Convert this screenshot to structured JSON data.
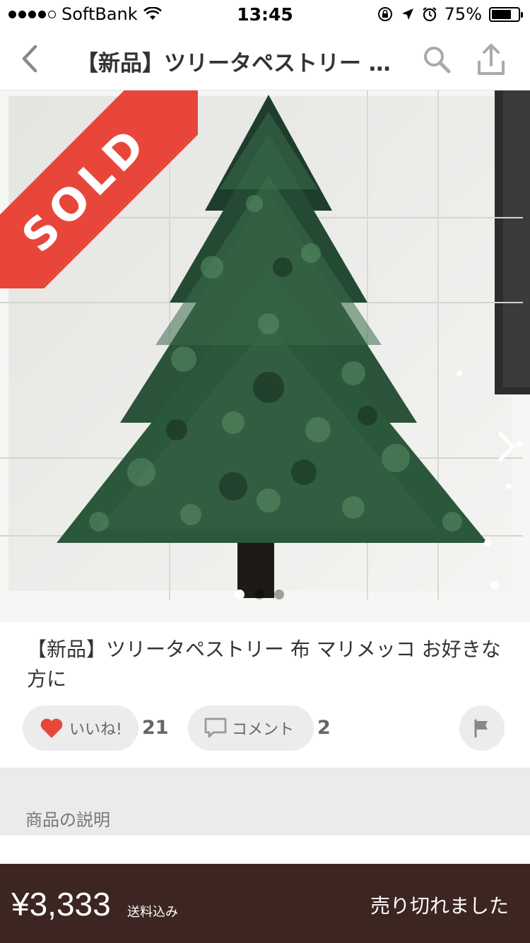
{
  "status_bar": {
    "carrier": "SoftBank",
    "time": "13:45",
    "battery": "75%",
    "battery_level": 0.75
  },
  "nav": {
    "title": "【新品】ツリータペストリー 布 マリメッコ お好きな方に"
  },
  "photo": {
    "badge": "SOLD",
    "badge_color": "#e8463b",
    "page_count": 3,
    "current_page": 1
  },
  "item": {
    "title": "【新品】ツリータペストリー 布 マリメッコ お好きな方に"
  },
  "actions": {
    "like_label": "いいね!",
    "like_count": "21",
    "comment_label": "コメント",
    "comment_count": "2"
  },
  "section": {
    "description_heading": "商品の説明"
  },
  "bottom": {
    "price": "¥3,333",
    "shipping": "送料込み",
    "status": "売り切れました",
    "background_color": "#3d2621"
  }
}
